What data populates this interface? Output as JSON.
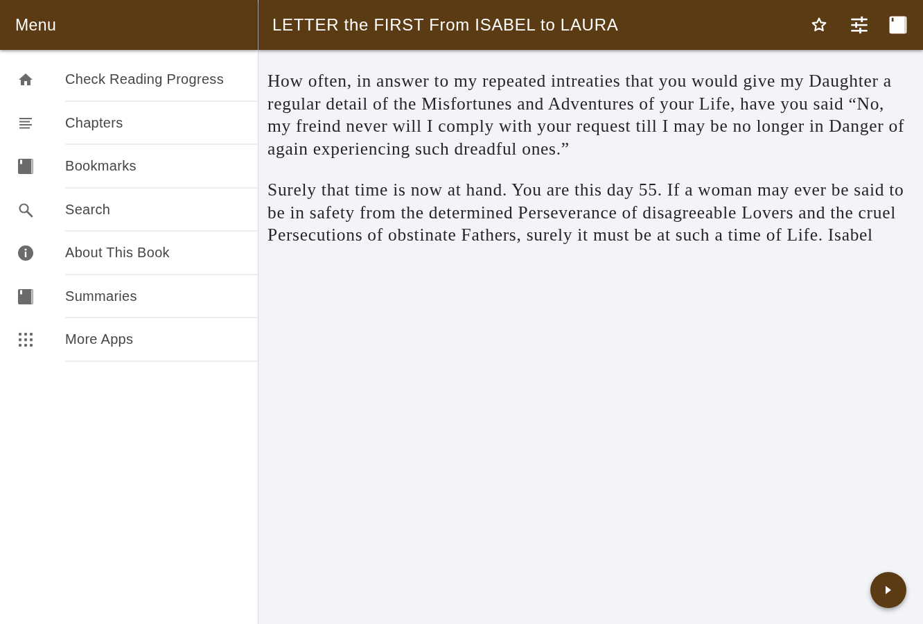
{
  "drawer": {
    "title": "Menu",
    "items": [
      {
        "label": "Check Reading Progress",
        "kind": "home"
      },
      {
        "label": "Chapters",
        "kind": "lines"
      },
      {
        "label": "Bookmarks",
        "kind": "book"
      },
      {
        "label": "Search",
        "kind": "search"
      },
      {
        "label": "About This Book",
        "kind": "info"
      },
      {
        "label": "Summaries",
        "kind": "book"
      },
      {
        "label": "More Apps",
        "kind": "grid"
      }
    ]
  },
  "reader": {
    "title": "LETTER the FIRST From ISABEL to LAURA",
    "paragraphs": [
      "How often, in answer to my repeated intreaties that you would give my Daughter a regular detail of the Misfortunes and Adventures of your Life, have you said “No, my freind never will I comply with your request till I may be no longer in Danger of again experiencing such dreadful ones.”",
      "Surely that time is now at hand. You are this day 55. If a woman may ever be said to be in safety from the determined Perseverance of disagreeable Lovers and the cruel Persecutions of obstinate Fathers, surely it must be at such a time of Life. Isabel"
    ]
  }
}
